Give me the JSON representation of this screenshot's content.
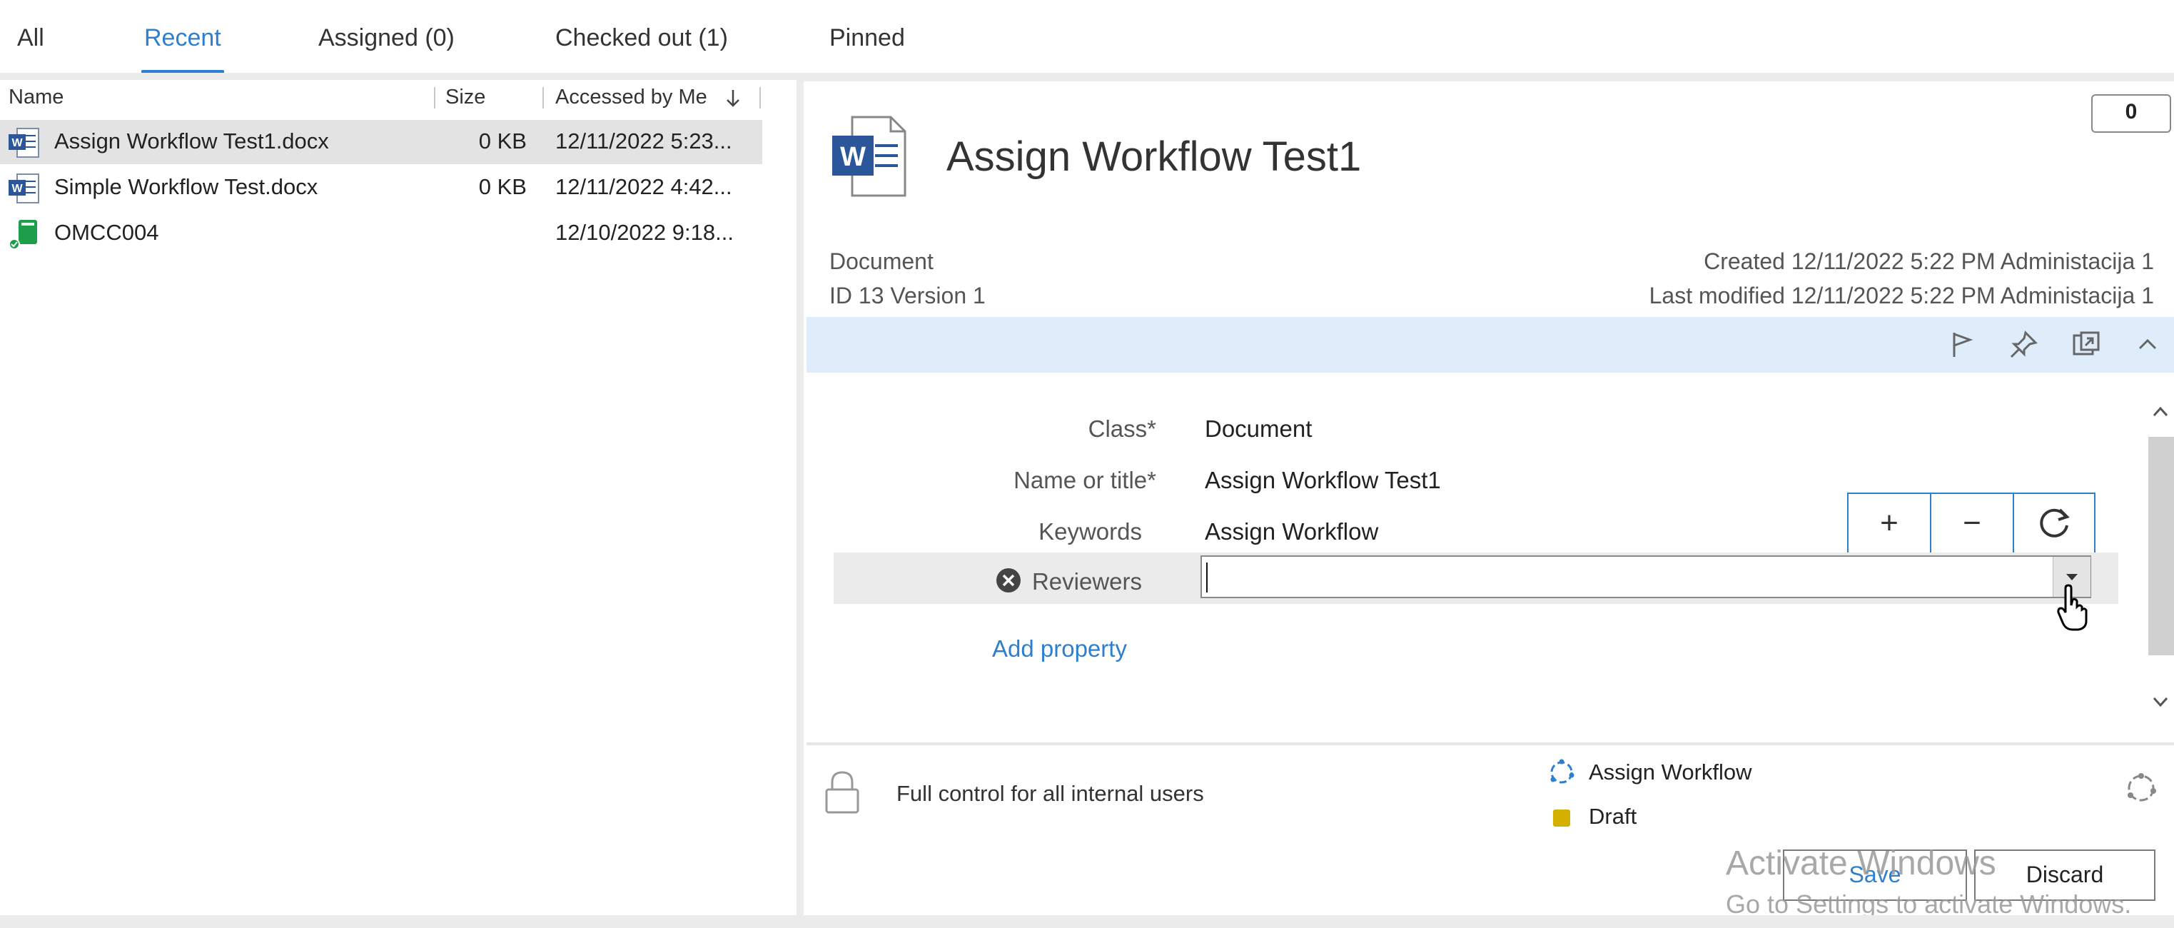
{
  "tabs": [
    {
      "label": "All"
    },
    {
      "label": "Recent"
    },
    {
      "label": "Assigned (0)"
    },
    {
      "label": "Checked out (1)"
    },
    {
      "label": "Pinned"
    }
  ],
  "list": {
    "columns": {
      "name": "Name",
      "size": "Size",
      "accessed": "Accessed by Me"
    },
    "rows": [
      {
        "name": "Assign Workflow Test1.docx",
        "size": "0 KB",
        "date": "12/11/2022 5:23...",
        "icon": "word-doc-icon"
      },
      {
        "name": "Simple Workflow Test.docx",
        "size": "0 KB",
        "date": "12/11/2022 4:42...",
        "icon": "word-doc-icon"
      },
      {
        "name": "OMCC004",
        "size": "",
        "date": "12/10/2022 9:18...",
        "icon": "green-document-icon"
      }
    ]
  },
  "detail": {
    "title": "Assign Workflow Test1",
    "comments_count": "0",
    "type_label": "Document",
    "id_version": "ID 13  Version 1",
    "created": "Created 12/11/2022 5:22 PM Administacija 1",
    "modified": "Last modified 12/11/2022 5:22 PM Administacija 1"
  },
  "properties": {
    "class_label": "Class",
    "class_value": "Document",
    "name_label": "Name or title",
    "name_value": "Assign Workflow Test1",
    "keywords_label": "Keywords",
    "keywords_value": "Assign Workflow",
    "reviewers_label": "Reviewers",
    "reviewers_value": "",
    "required_mark": "*",
    "add_property": "Add property"
  },
  "stepper": {
    "plus": "+",
    "minus": "−"
  },
  "footer": {
    "permissions": "Full control for all internal users",
    "workflow": "Assign Workflow",
    "state": "Draft",
    "state_color": "#d4b000",
    "save": "Save",
    "discard": "Discard"
  },
  "watermark": {
    "line1": "Activate Windows",
    "line2": "Go to Settings to activate Windows."
  },
  "colors": {
    "accent": "#2f7fcf",
    "selected_row": "#e3e3e3",
    "toolbar_band": "#dfecf9"
  }
}
